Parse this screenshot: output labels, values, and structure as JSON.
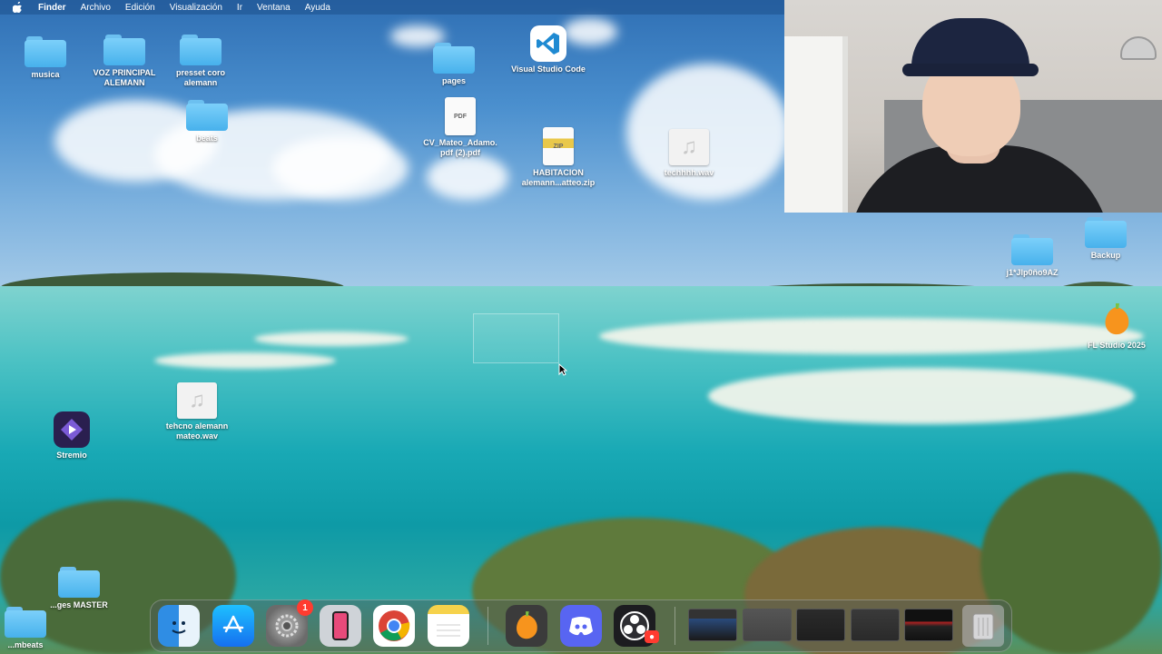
{
  "menubar": {
    "app": "Finder",
    "items": [
      "Archivo",
      "Edición",
      "Visualización",
      "Ir",
      "Ventana",
      "Ayuda"
    ]
  },
  "desktop": {
    "icons": {
      "musica": "musica",
      "voz": "VOZ PRINCIPAL\nALEMANN",
      "presset": "presset coro\nalemann",
      "beats": "beats",
      "pages": "pages",
      "vscode": "Visual Studio Code",
      "cv": "CV_Mateo_Adamo.\npdf (2).pdf",
      "habitacion": "HABITACION\nalemann...atteo.zip",
      "techhh": "techhhh.wav",
      "weird": "j1*Jlp0ño9AZ",
      "backup": "Backup",
      "flstudio": "FL Studio 2025",
      "stremio": "Stremio",
      "tehcno": "tehcno alemann\nmateo.wav",
      "master": "...ges MASTER",
      "bottom": "...mbeats"
    },
    "file_badges": {
      "pdf": "PDF",
      "zip": "ZIP"
    }
  },
  "dock": {
    "apps": [
      "Finder",
      "App Store",
      "System Settings",
      "iPhone Mirroring",
      "Google Chrome",
      "Notes",
      "FL Studio",
      "Discord",
      "OBS"
    ],
    "settings_badge": "1"
  }
}
